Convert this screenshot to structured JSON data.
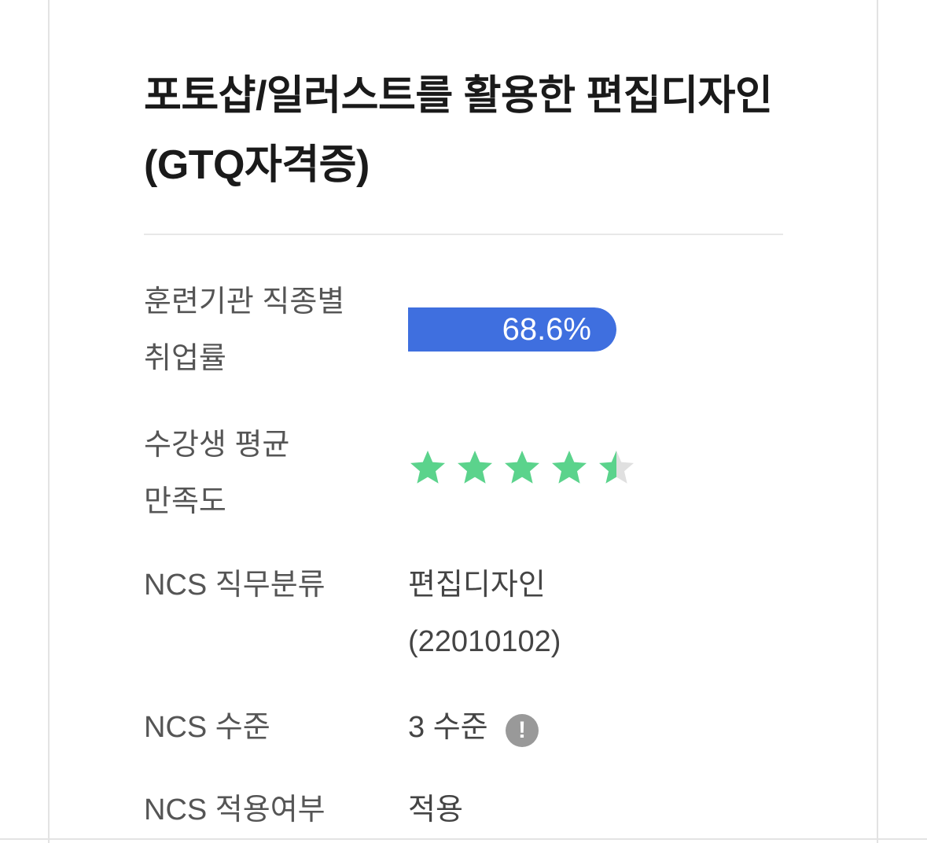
{
  "course": {
    "title": "포토샵/일러스트를 활용한 편집디자인(GTQ자격증)"
  },
  "details": {
    "employment_rate": {
      "label": "훈련기관 직종별\n취업률",
      "value_text": "68.6%",
      "value_percent": 68.6
    },
    "satisfaction": {
      "label": "수강생 평균\n만족도",
      "rating": 4.5,
      "max": 5
    },
    "ncs_job": {
      "label": "NCS 직무분류",
      "value": "편집디자인\n(22010102)"
    },
    "ncs_level": {
      "label": "NCS 수준",
      "value": "3 수준",
      "info_icon": "exclamation-info-icon"
    },
    "ncs_applied": {
      "label": "NCS 적용여부",
      "value": "적용"
    }
  },
  "colors": {
    "rate_bar": "#3f6fdf",
    "star_filled": "#5bd38c",
    "star_empty": "#e0e0e0"
  }
}
